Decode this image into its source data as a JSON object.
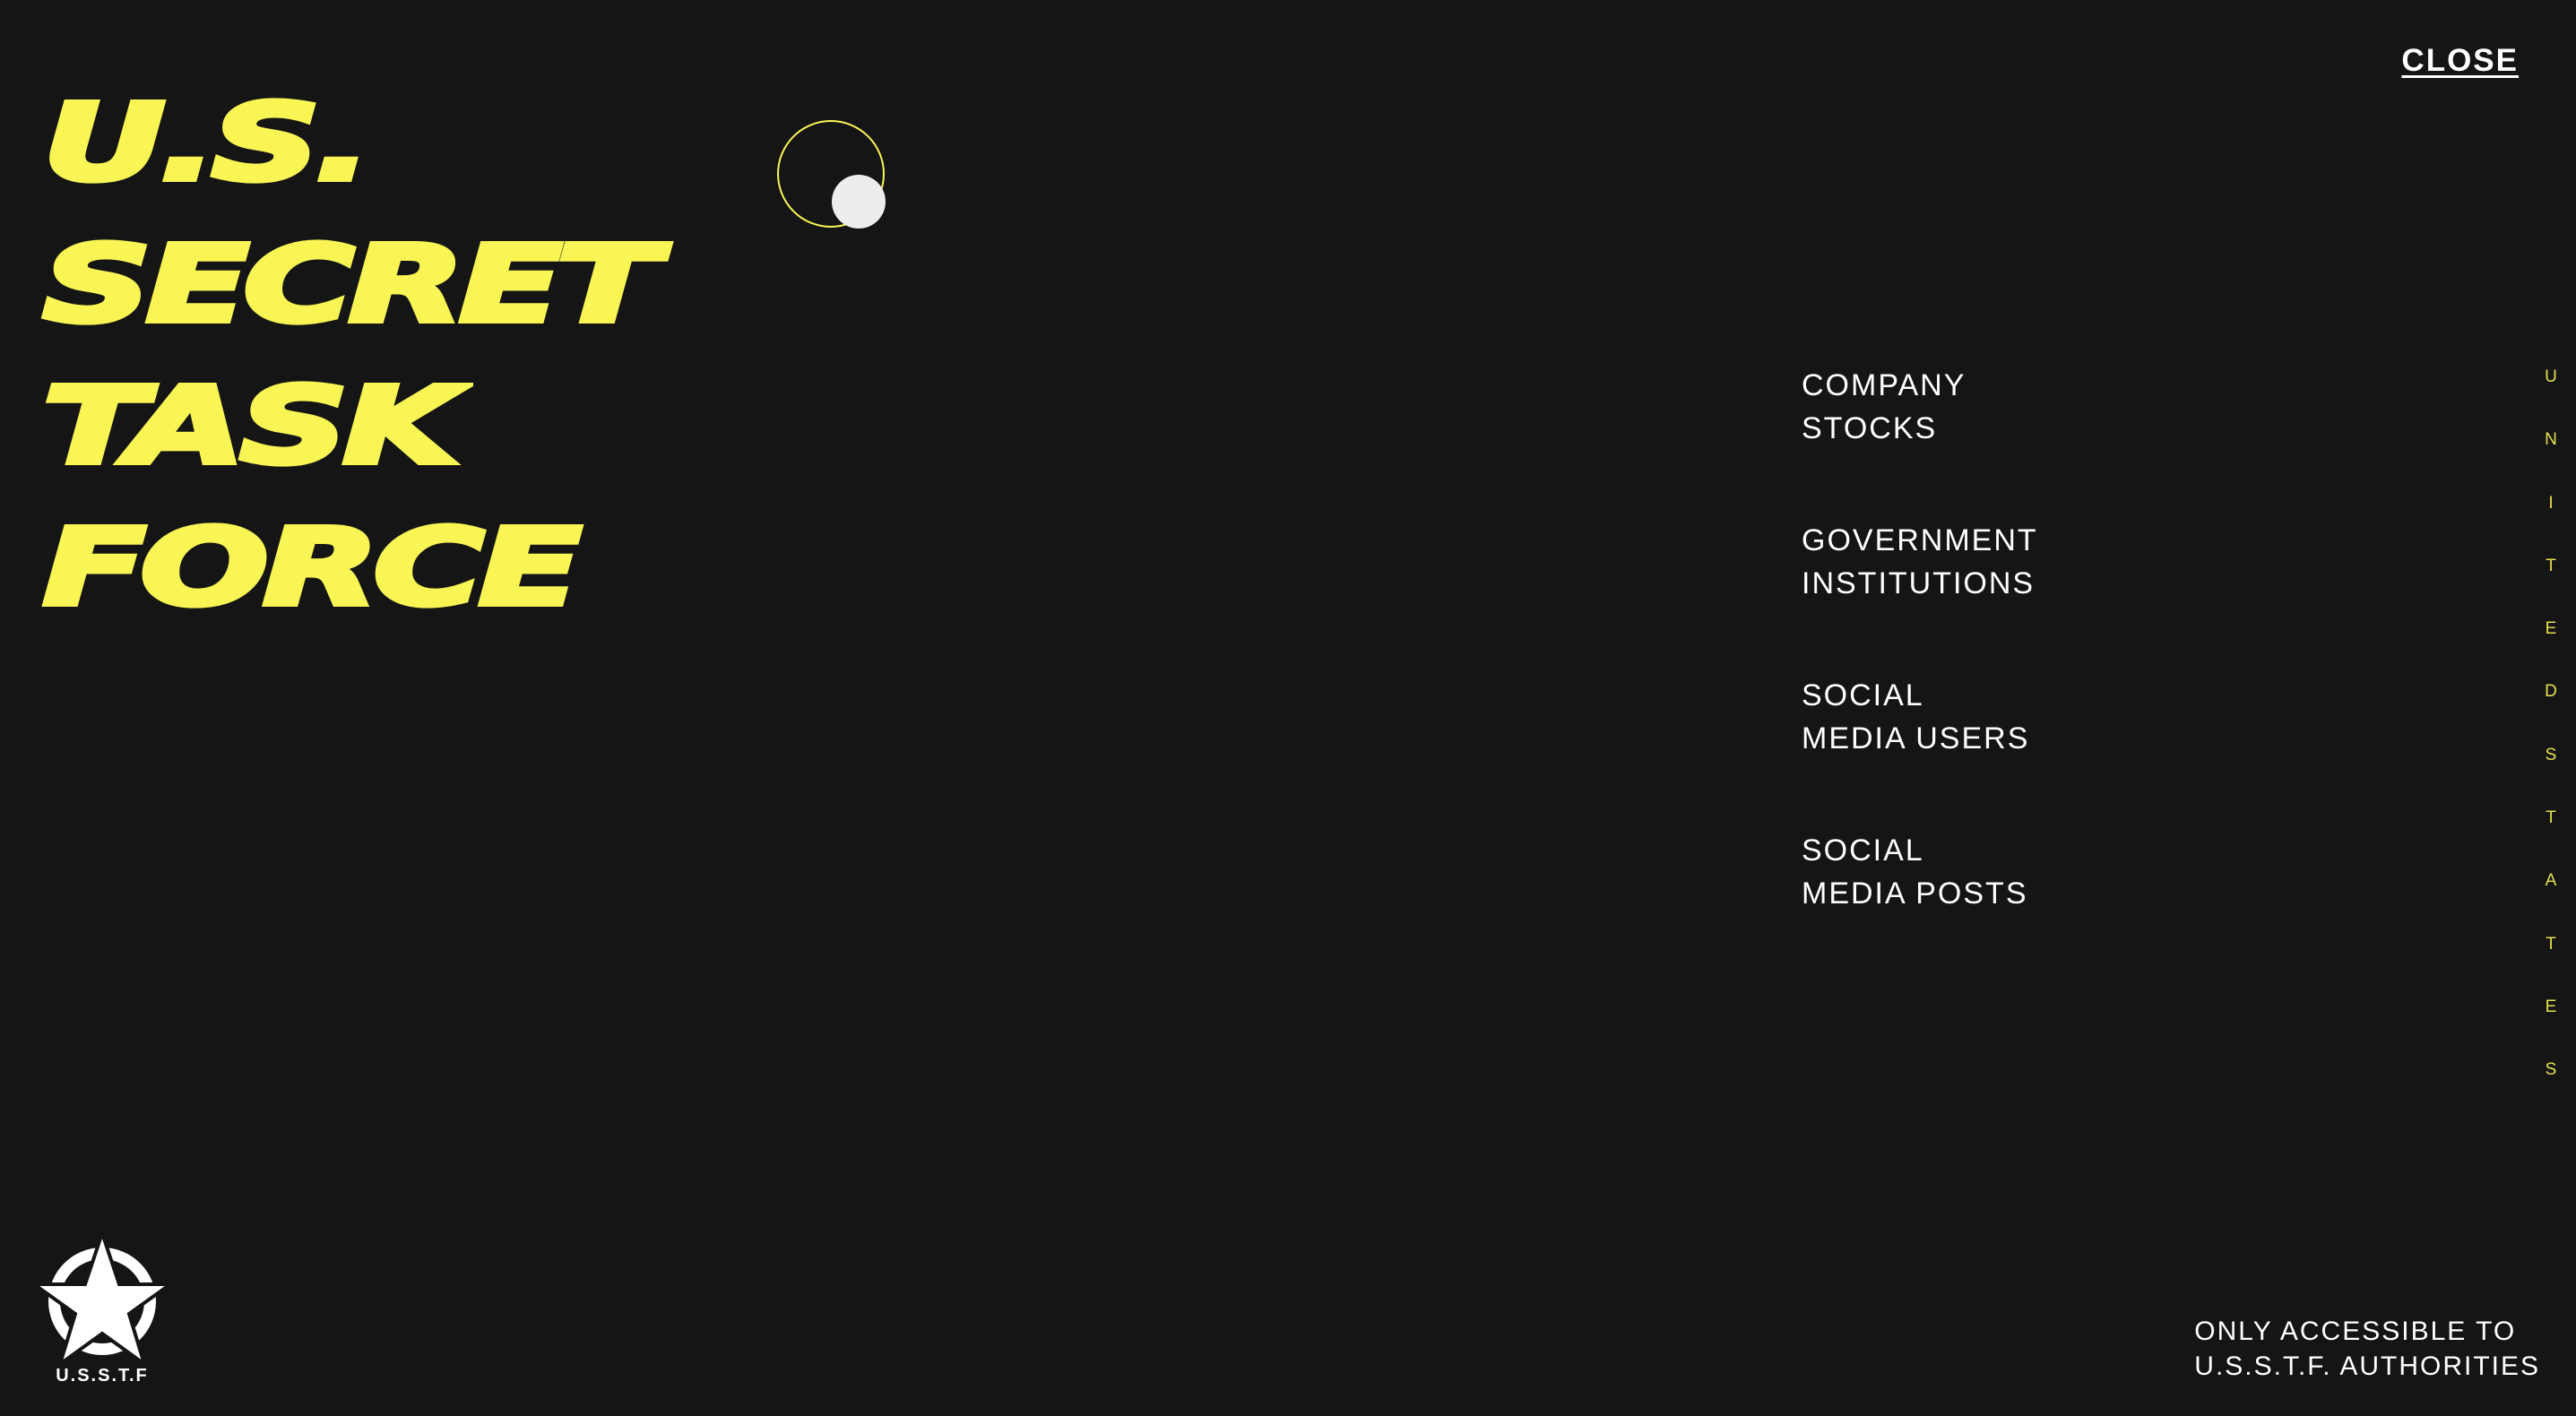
{
  "header": {
    "close_label": "CLOSE"
  },
  "hero": {
    "title_lines": [
      "U.S.",
      "SECRET",
      "TASK",
      "FORCE"
    ]
  },
  "menu": {
    "items": [
      {
        "line1": "COMPANY",
        "line2": "STOCKS"
      },
      {
        "line1": "GOVERNMENT",
        "line2": "INSTITUTIONS"
      },
      {
        "line1": "SOCIAL",
        "line2": "MEDIA USERS"
      },
      {
        "line1": "SOCIAL",
        "line2": "MEDIA POSTS"
      }
    ]
  },
  "side_text": {
    "letters": [
      "U",
      "N",
      "I",
      "T",
      "E",
      "D",
      "S",
      "T",
      "A",
      "T",
      "E",
      "S"
    ]
  },
  "logo": {
    "label": "U.S.S.T.F",
    "icon": "star-emblem-icon"
  },
  "footer": {
    "access_line1": "ONLY ACCESSIBLE TO",
    "access_line2": "U.S.S.T.F. AUTHORITIES"
  },
  "colors": {
    "background": "#151515",
    "accent_yellow": "#F8F554",
    "text": "#FFFFFF"
  }
}
